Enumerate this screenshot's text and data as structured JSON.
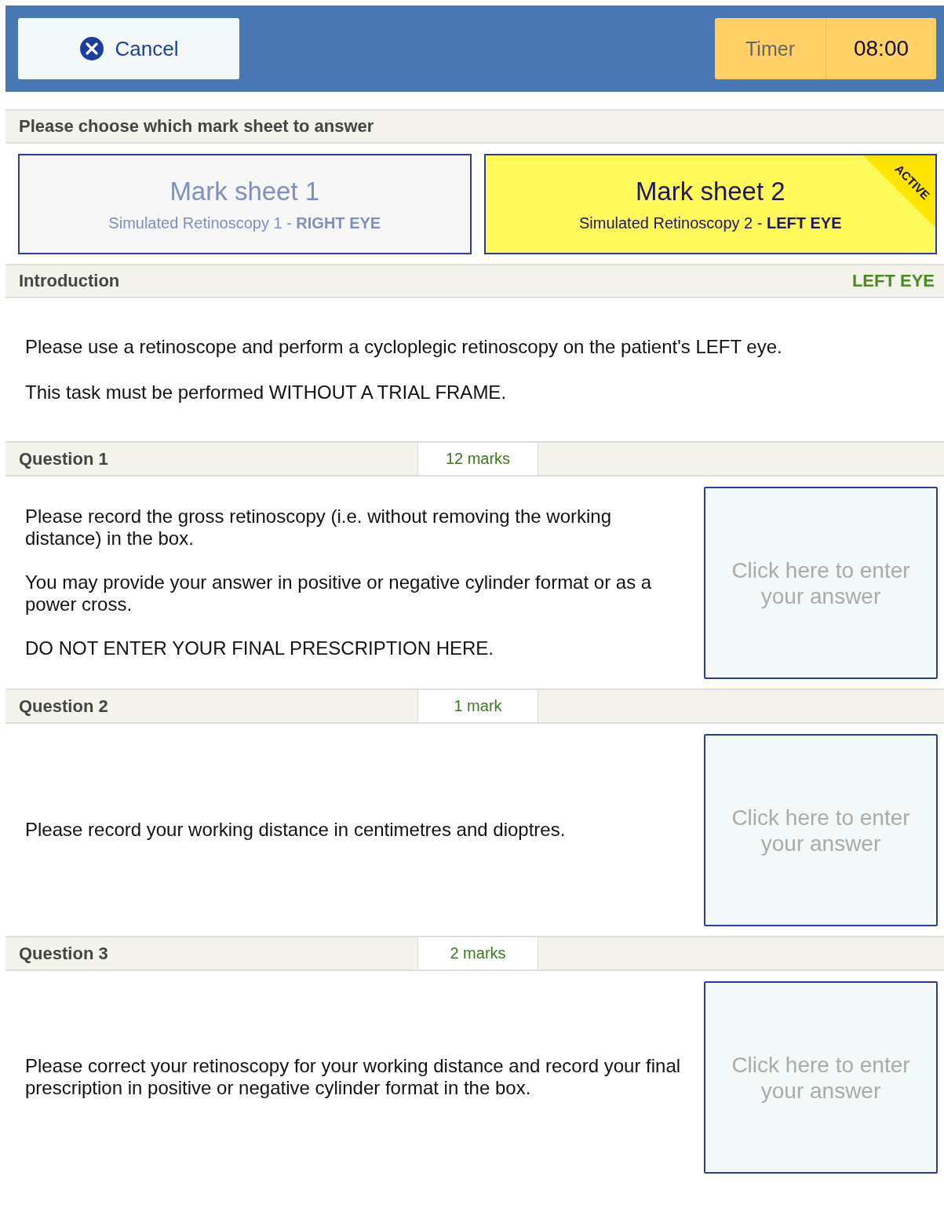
{
  "header": {
    "cancel_label": "Cancel",
    "timer_label": "Timer",
    "timer_value": "08:00"
  },
  "sheet_prompt": "Please choose which mark sheet to answer",
  "mark_sheets": [
    {
      "title": "Mark sheet 1",
      "subtitle": "Simulated Retinoscopy 1 - **RIGHT EYE**",
      "selected": false
    },
    {
      "title": "Mark sheet 2",
      "subtitle": "Simulated Retinoscopy 2 - **LEFT EYE**",
      "selected": true,
      "badge": "ACTIVE"
    }
  ],
  "introduction": {
    "title": "Introduction",
    "eye": "LEFT EYE",
    "paragraphs": [
      "Please use a retinoscope and perform a cycloplegic retinoscopy on the patient's LEFT eye.",
      "This task must be performed WITHOUT A TRIAL FRAME."
    ]
  },
  "questions": [
    {
      "title": "Question 1",
      "marks": "12 marks",
      "paragraphs": [
        "Please record the gross retinoscopy (i.e. without removing the working distance) in the box.",
        "You may provide your answer in positive or negative cylinder format or as a power cross.",
        "DO NOT ENTER YOUR FINAL PRESCRIPTION HERE."
      ],
      "placeholder": "Click here to enter your answer"
    },
    {
      "title": "Question 2",
      "marks": "1 mark",
      "paragraphs": [
        "Please record your working distance in centimetres and dioptres."
      ],
      "placeholder": "Click here to enter your answer"
    },
    {
      "title": "Question 3",
      "marks": "2 marks",
      "paragraphs": [
        "Please correct your retinoscopy for your working distance and record your final prescription in positive or negative cylinder format in the box."
      ],
      "placeholder": "Click here to enter your answer"
    }
  ]
}
